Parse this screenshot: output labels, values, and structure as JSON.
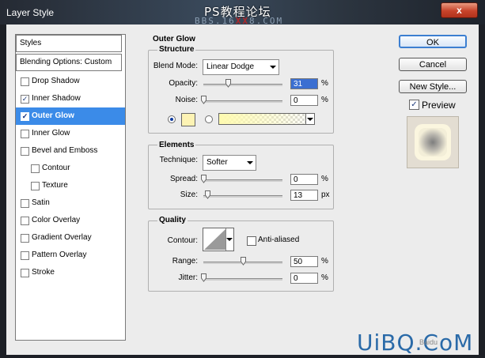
{
  "window": {
    "title": "Layer Style",
    "close_glyph": "x"
  },
  "watermark": {
    "line1": "PS教程论坛",
    "line2_pre": "BBS.16",
    "line2_red": "XX",
    "line2_post": "8.COM",
    "bottom": "UiBQ.CoM",
    "bottom_small": "Baidu"
  },
  "styles_panel": {
    "header": "Styles",
    "blending": "Blending Options: Custom",
    "items": [
      {
        "label": "Drop Shadow",
        "checked": false,
        "sub": false,
        "selected": false
      },
      {
        "label": "Inner Shadow",
        "checked": true,
        "sub": false,
        "selected": false
      },
      {
        "label": "Outer Glow",
        "checked": true,
        "sub": false,
        "selected": true
      },
      {
        "label": "Inner Glow",
        "checked": false,
        "sub": false,
        "selected": false
      },
      {
        "label": "Bevel and Emboss",
        "checked": false,
        "sub": false,
        "selected": false
      },
      {
        "label": "Contour",
        "checked": false,
        "sub": true,
        "selected": false
      },
      {
        "label": "Texture",
        "checked": false,
        "sub": true,
        "selected": false
      },
      {
        "label": "Satin",
        "checked": false,
        "sub": false,
        "selected": false
      },
      {
        "label": "Color Overlay",
        "checked": false,
        "sub": false,
        "selected": false
      },
      {
        "label": "Gradient Overlay",
        "checked": false,
        "sub": false,
        "selected": false
      },
      {
        "label": "Pattern Overlay",
        "checked": false,
        "sub": false,
        "selected": false
      },
      {
        "label": "Stroke",
        "checked": false,
        "sub": false,
        "selected": false
      }
    ]
  },
  "outer_glow": {
    "title": "Outer Glow",
    "structure": {
      "title": "Structure",
      "blend_mode_label": "Blend Mode:",
      "blend_mode_value": "Linear Dodge",
      "opacity_label": "Opacity:",
      "opacity_value": "31",
      "opacity_unit": "%",
      "opacity_fraction": 0.31,
      "noise_label": "Noise:",
      "noise_value": "0",
      "noise_unit": "%",
      "noise_fraction": 0,
      "color_swatch": "#fdf3b4",
      "gradient_from": "#fffbb0"
    },
    "elements": {
      "title": "Elements",
      "technique_label": "Technique:",
      "technique_value": "Softer",
      "spread_label": "Spread:",
      "spread_value": "0",
      "spread_unit": "%",
      "spread_fraction": 0,
      "size_label": "Size:",
      "size_value": "13",
      "size_unit": "px",
      "size_fraction": 0.05
    },
    "quality": {
      "title": "Quality",
      "contour_label": "Contour:",
      "antialiased_label": "Anti-aliased",
      "antialiased_checked": false,
      "range_label": "Range:",
      "range_value": "50",
      "range_unit": "%",
      "range_fraction": 0.5,
      "jitter_label": "Jitter:",
      "jitter_value": "0",
      "jitter_unit": "%",
      "jitter_fraction": 0
    }
  },
  "buttons": {
    "ok": "OK",
    "cancel": "Cancel",
    "new_style": "New Style...",
    "preview_label": "Preview",
    "preview_checked": true
  }
}
